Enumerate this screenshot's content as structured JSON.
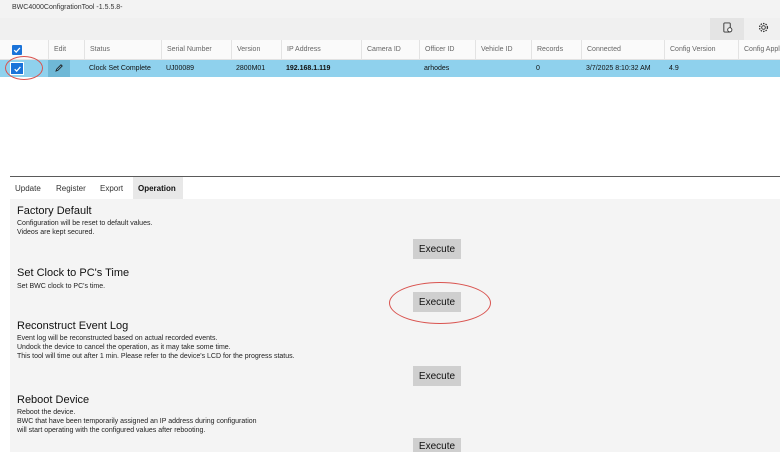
{
  "window": {
    "title": "BWC4000ConfigrationTool -1.5.5.8-"
  },
  "toolbar": {
    "icon1": "device-settings-icon",
    "icon2": "gear-icon"
  },
  "grid": {
    "columns": [
      "Edit",
      "Status",
      "Serial Number",
      "Version",
      "IP Address",
      "Camera ID",
      "Officer ID",
      "Vehicle ID",
      "Records",
      "Connected",
      "Config Version",
      "Config Appl"
    ],
    "row": {
      "checked": true,
      "status": "Clock Set Complete",
      "serial": "UJ00089",
      "version": "2800M01",
      "ip": "192.168.1.119",
      "camera_id": "",
      "officer_id": "arhodes",
      "vehicle_id": "",
      "records": "0",
      "connected": "3/7/2025 8:10:32 AM",
      "config_version": "4.9",
      "config_appl": ""
    }
  },
  "tabs": [
    "Update",
    "Register",
    "Export",
    "Operation"
  ],
  "active_tab": "Operation",
  "operations": [
    {
      "title": "Factory Default",
      "lines": [
        "Configuration will be reset to default values.",
        "Videos are kept secured."
      ],
      "button": "Execute"
    },
    {
      "title": "Set Clock to PC's Time",
      "lines": [
        "Set BWC clock to PC's time."
      ],
      "button": "Execute"
    },
    {
      "title": "Reconstruct Event Log",
      "lines": [
        "Event log will be reconstructed based on actual recorded events.",
        "Undock the device to cancel the operation, as it may take some time.",
        "This tool will time out after 1 min. Please refer to the device's LCD for the progress status."
      ],
      "button": "Execute"
    },
    {
      "title": "Reboot Device",
      "lines": [
        "Reboot the device.",
        "BWC that have been temporarily assigned an IP address during configuration",
        "will start operating with the configured values after rebooting."
      ],
      "button": "Execute"
    }
  ],
  "colors": {
    "selection": "#8fd1ed",
    "checkbox": "#1a73d9",
    "annotation": "#d9534f"
  }
}
